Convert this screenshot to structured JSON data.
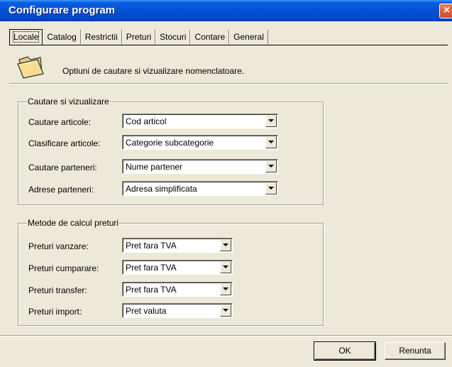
{
  "window": {
    "title": "Configurare program",
    "close_label": "×"
  },
  "tabs": [
    {
      "label": "Locale",
      "active": true
    },
    {
      "label": "Catalog"
    },
    {
      "label": "Restrictii"
    },
    {
      "label": "Preturi"
    },
    {
      "label": "Stocuri"
    },
    {
      "label": "Contare"
    },
    {
      "label": "General"
    }
  ],
  "header": {
    "icon": "open-folder-icon",
    "description": "Optiuni de cautare si vizualizare nomenclatoare."
  },
  "search_group": {
    "title": "Cautare si vizualizare",
    "rows": [
      {
        "label": "Cautare articole:",
        "value": "Cod articol"
      },
      {
        "label": "Clasificare articole:",
        "value": "Categorie subcategorie"
      },
      {
        "label": "Cautare parteneri:",
        "value": "Nume partener"
      },
      {
        "label": "Adrese parteneri:",
        "value": "Adresa simplificata"
      }
    ]
  },
  "price_group": {
    "title": "Metode de calcul preturi",
    "rows": [
      {
        "label": "Preturi vanzare:",
        "value": "Pret fara TVA"
      },
      {
        "label": "Preturi cumparare:",
        "value": "Pret fara TVA"
      },
      {
        "label": "Preturi transfer:",
        "value": "Pret fara TVA"
      },
      {
        "label": "Preturi import:",
        "value": "Pret valuta"
      }
    ]
  },
  "footer": {
    "ok_label": "OK",
    "cancel_label": "Renunta"
  },
  "colors": {
    "titlebar": "#0450d7",
    "dialog_bg": "#ece9d8",
    "close_button": "#d24a28"
  }
}
